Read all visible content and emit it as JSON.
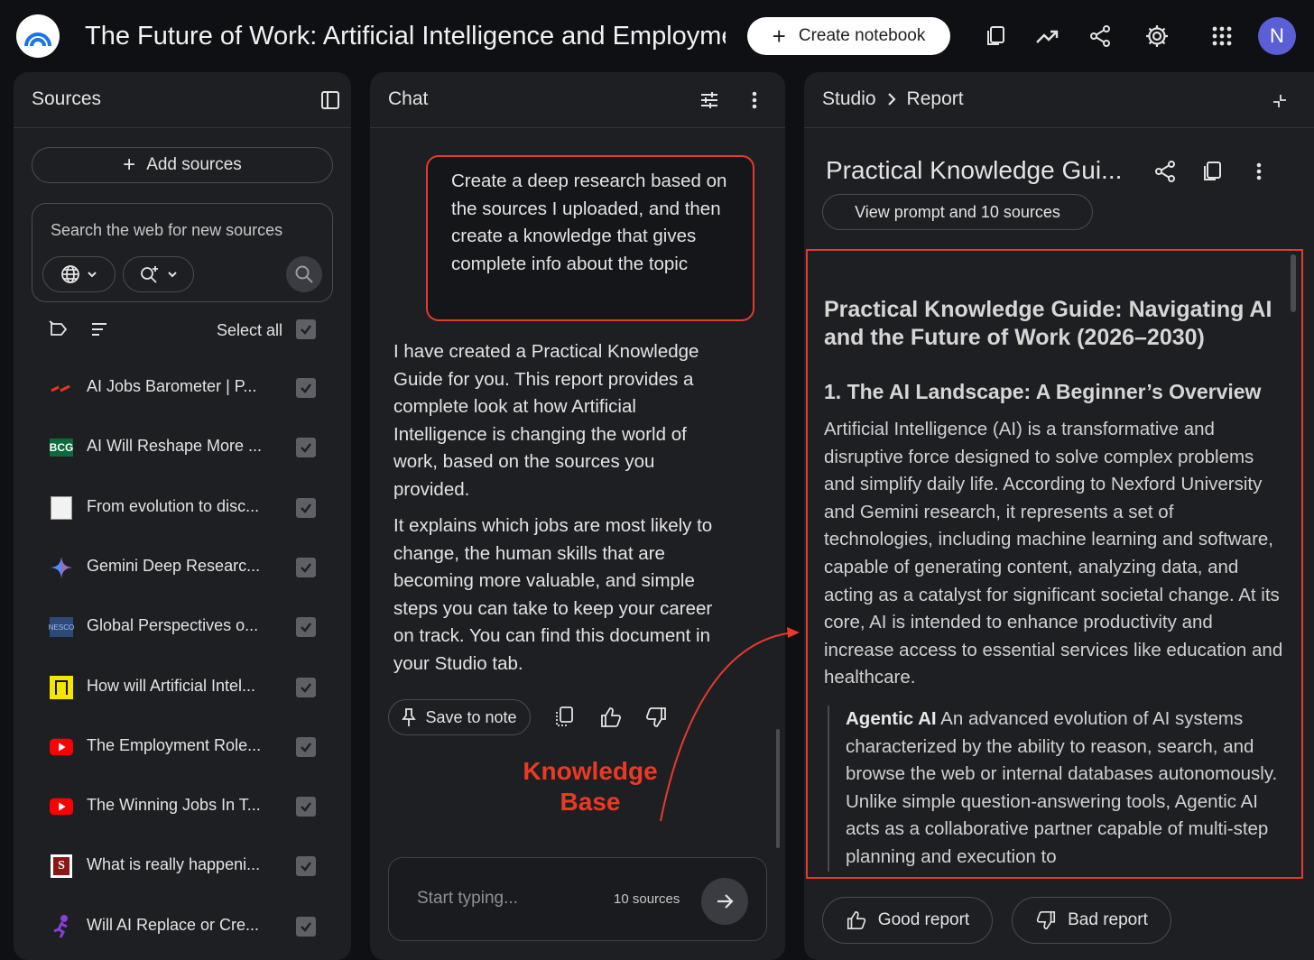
{
  "header": {
    "title": "The Future of Work: Artificial Intelligence and Employment",
    "create_label": "Create notebook",
    "avatar_initial": "N"
  },
  "sources": {
    "title": "Sources",
    "add_label": "Add sources",
    "search_placeholder": "Search the web for new sources",
    "select_all": "Select all",
    "items": [
      {
        "label": "AI Jobs Barometer | P...",
        "icon": "pwc-logo"
      },
      {
        "label": "AI Will Reshape More ...",
        "icon": "bcg-logo"
      },
      {
        "label": "From evolution to disc...",
        "icon": "doc-thumbnail"
      },
      {
        "label": "Gemini Deep Researc...",
        "icon": "gemini-logo"
      },
      {
        "label": "Global Perspectives o...",
        "icon": "unesco-logo"
      },
      {
        "label": "How will Artificial Intel...",
        "icon": "nu-logo"
      },
      {
        "label": "The Employment Role...",
        "icon": "youtube-logo"
      },
      {
        "label": "The Winning Jobs In T...",
        "icon": "youtube-logo"
      },
      {
        "label": "What is really happeni...",
        "icon": "stanford-logo"
      },
      {
        "label": "Will AI Replace or Cre...",
        "icon": "runner-logo"
      }
    ]
  },
  "chat": {
    "title": "Chat",
    "user_message": "Create a deep research based on the sources I uploaded, and then create a knowledge that gives complete info about the topic",
    "bot_paragraphs": [
      "I have created a Practical Knowledge Guide for you. This report provides a complete look at how Artificial Intelligence is changing the world of work, based on the sources you provided.",
      "It explains which jobs are most likely to change, the human skills that are becoming more valuable, and simple steps you can take to keep your career on track. You can find this document in your Studio tab."
    ],
    "save_label": "Save to note",
    "input_placeholder": "Start typing...",
    "source_count": "10 sources",
    "annotation": {
      "line1": "Knowledge",
      "line2": "Base",
      "color": "#ea3a23"
    }
  },
  "studio": {
    "crumb_root": "Studio",
    "crumb_current": "Report",
    "doc_title": "Practical Knowledge Gui...",
    "view_prompt": "View prompt and 10 sources",
    "report": {
      "h1": "Practical Knowledge Guide: Navigating AI and the Future of Work (2026–2030)",
      "h2": "1. The AI Landscape: A Beginner’s Overview",
      "paragraph": "Artificial Intelligence (AI) is a transformative and disruptive force designed to solve complex problems and simplify daily life. According to Nexford University and Gemini research, it represents a set of technologies, including machine learning and software, capable of generating content, analyzing data, and acting as a catalyst for significant societal change. At its core, AI is intended to enhance productivity and increase access to essential services like education and healthcare.",
      "quote_term": "Agentic AI",
      "quote_text": " An advanced evolution of AI systems characterized by the ability to reason, search, and browse the web or internal databases autonomously. Unlike simple question-answering tools, Agentic AI acts as a collaborative partner capable of multi-step planning and execution to"
    },
    "good_label": "Good report",
    "bad_label": "Bad report"
  },
  "colors": {
    "highlight": "#e53a2e",
    "avatar": "#5b5fd6"
  }
}
